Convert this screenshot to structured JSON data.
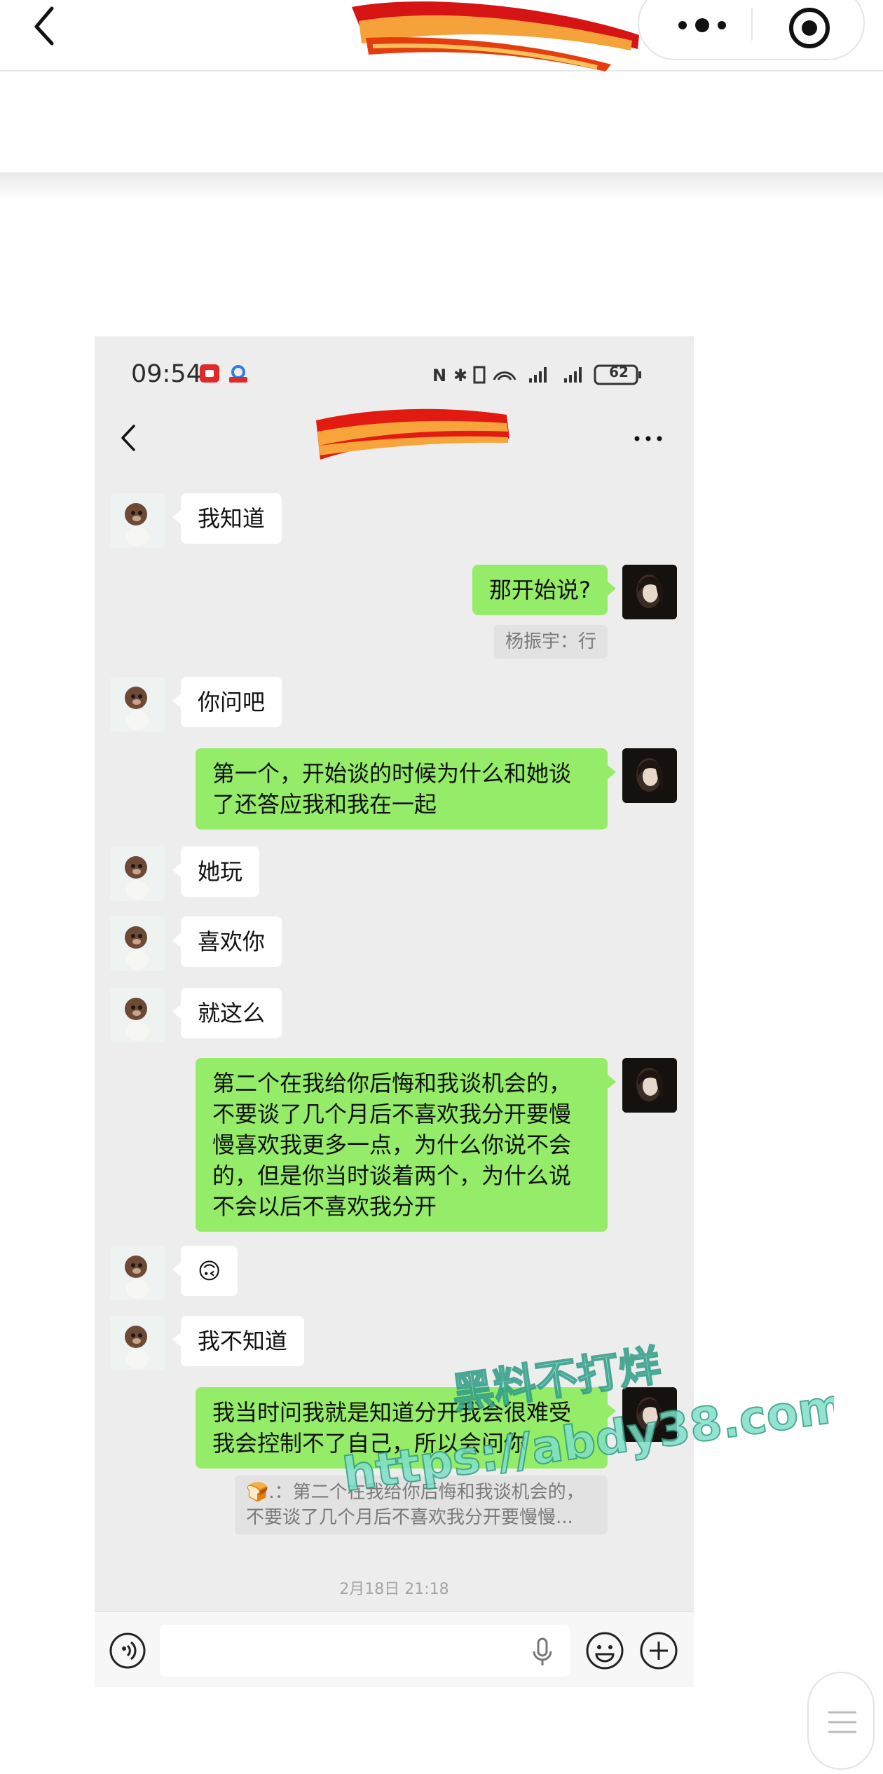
{
  "outer": {
    "topbar": {
      "back_icon": "chevron-left-icon",
      "more_icon": "more-dots-icon",
      "close_icon": "target-circle-icon"
    }
  },
  "phone": {
    "status_bar": {
      "time": "09:54",
      "battery": "62"
    },
    "chat": {
      "title": "",
      "more_icon": "more-dots-icon",
      "messages": [
        {
          "side": "in",
          "text": "我知道"
        },
        {
          "side": "out",
          "text": "那开始说?"
        },
        {
          "side": "quote",
          "text": "杨振宇：行"
        },
        {
          "side": "in",
          "text": "你问吧"
        },
        {
          "side": "out",
          "text": "第一个，开始谈的时候为什么和她谈了还答应我和我在一起"
        },
        {
          "side": "in",
          "text": "她玩"
        },
        {
          "side": "in",
          "text": "喜欢你"
        },
        {
          "side": "in",
          "text": "就这么"
        },
        {
          "side": "out",
          "text": "第二个在我给你后悔和我谈机会的，不要谈了几个月后不喜欢我分开要慢慢喜欢我更多一点，为什么你说不会的，但是你当时谈着两个，为什么说不会以后不喜欢我分开"
        },
        {
          "side": "in",
          "text": "🙃"
        },
        {
          "side": "in",
          "text": "我不知道"
        },
        {
          "side": "out",
          "text": "我当时问我就是知道分开我会很难受我会控制不了自己，所以会问你"
        },
        {
          "side": "quote",
          "text": "🍞.：第二个在我给你后悔和我谈机会的，不要谈了几个月后不喜欢我分开要慢慢..."
        }
      ],
      "timestamp": "2月18日 21:18"
    },
    "input_bar": {
      "placeholder": ""
    }
  },
  "watermark": {
    "line1": "黑料不打烊",
    "line2": "https://abdy38.com"
  },
  "colors": {
    "out_bubble": "#95ec69",
    "in_bubble": "#ffffff",
    "chat_bg": "#ededed"
  }
}
